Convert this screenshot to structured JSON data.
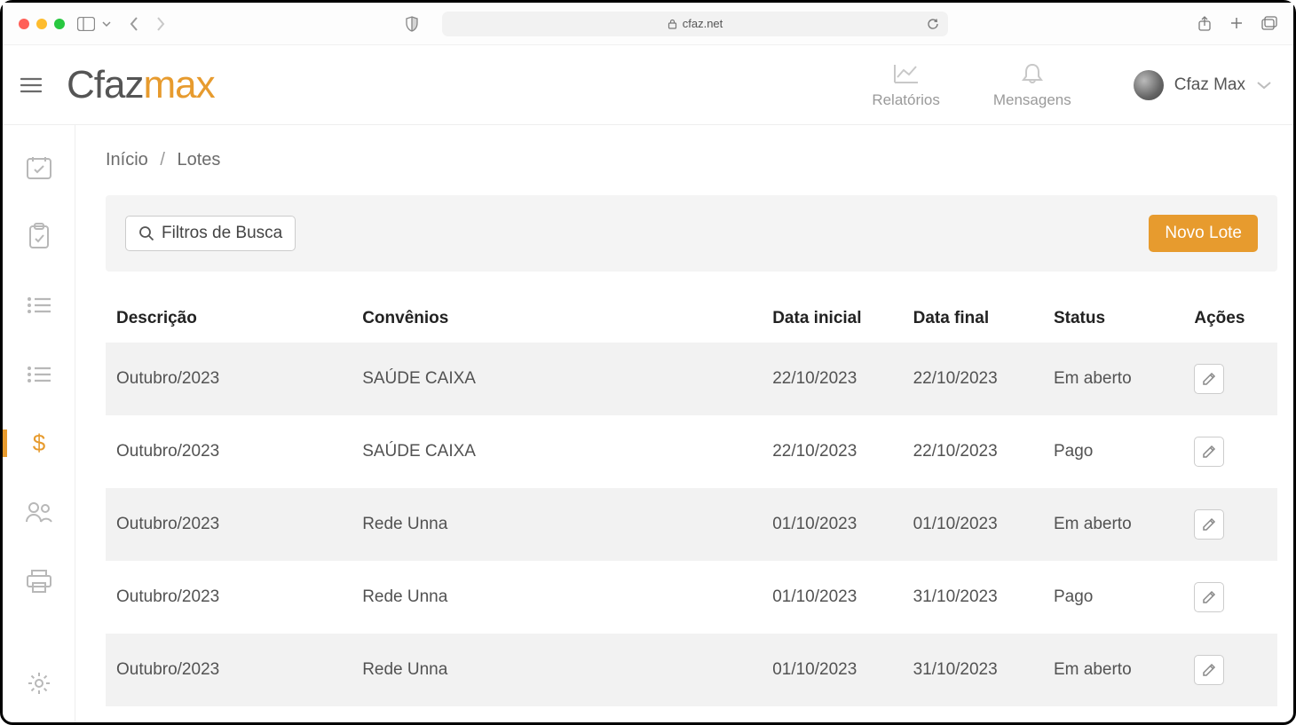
{
  "browser": {
    "url": "cfaz.net"
  },
  "logo": {
    "part1": "Cfaz",
    "part2": "max"
  },
  "header": {
    "reports_label": "Relatórios",
    "messages_label": "Mensagens",
    "user_name": "Cfaz Max"
  },
  "breadcrumb": {
    "home": "Início",
    "current": "Lotes"
  },
  "toolbar": {
    "filter_label": "Filtros de Busca",
    "new_label": "Novo Lote"
  },
  "table": {
    "headers": {
      "descricao": "Descrição",
      "convenios": "Convênios",
      "data_inicial": "Data inicial",
      "data_final": "Data final",
      "status": "Status",
      "acoes": "Ações"
    },
    "rows": [
      {
        "descricao": "Outubro/2023",
        "convenios": "SAÚDE CAIXA",
        "data_inicial": "22/10/2023",
        "data_final": "22/10/2023",
        "status": "Em aberto"
      },
      {
        "descricao": "Outubro/2023",
        "convenios": "SAÚDE CAIXA",
        "data_inicial": "22/10/2023",
        "data_final": "22/10/2023",
        "status": "Pago"
      },
      {
        "descricao": "Outubro/2023",
        "convenios": "Rede Unna",
        "data_inicial": "01/10/2023",
        "data_final": "01/10/2023",
        "status": "Em aberto"
      },
      {
        "descricao": "Outubro/2023",
        "convenios": "Rede Unna",
        "data_inicial": "01/10/2023",
        "data_final": "31/10/2023",
        "status": "Pago"
      },
      {
        "descricao": "Outubro/2023",
        "convenios": "Rede Unna",
        "data_inicial": "01/10/2023",
        "data_final": "31/10/2023",
        "status": "Em aberto"
      }
    ]
  }
}
